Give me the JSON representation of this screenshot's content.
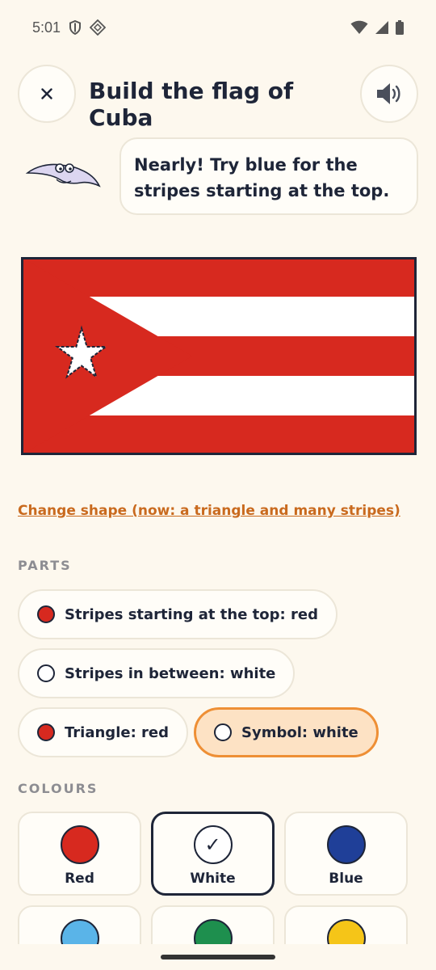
{
  "status": {
    "time": "5:01"
  },
  "header": {
    "title": "Build the flag of Cuba"
  },
  "feedback": {
    "message": "Nearly! Try blue for the stripes starting at the top."
  },
  "flag_colors": {
    "red": "#d7291f",
    "white": "#ffffff",
    "outline": "#1e2538"
  },
  "change_shape_link": "Change shape (now: a triangle and many stripes)",
  "parts": {
    "heading": "PARTS",
    "items": [
      {
        "label": "Stripes starting at the top: red",
        "dot_color": "#d7291f"
      },
      {
        "label": "Stripes in between: white",
        "dot_color": "#ffffff"
      },
      {
        "label": "Triangle: red",
        "dot_color": "#d7291f"
      },
      {
        "label": "Symbol: white",
        "dot_color": "#ffffff",
        "selected": true
      }
    ]
  },
  "colours": {
    "heading": "COLOURS",
    "items": [
      {
        "label": "Red",
        "hex": "#d7291f"
      },
      {
        "label": "White",
        "hex": "#ffffff",
        "selected": true,
        "checkmark": "✓"
      },
      {
        "label": "Blue",
        "hex": "#1f3f98"
      },
      {
        "label": "",
        "hex": "#5ab4e8"
      },
      {
        "label": "",
        "hex": "#1e8f4e"
      },
      {
        "label": "",
        "hex": "#f5c518"
      }
    ]
  },
  "accent_colors": {
    "link": "#c96a1e",
    "selected_chip_border": "#ee8f35",
    "selected_chip_bg": "#fde2c4"
  }
}
